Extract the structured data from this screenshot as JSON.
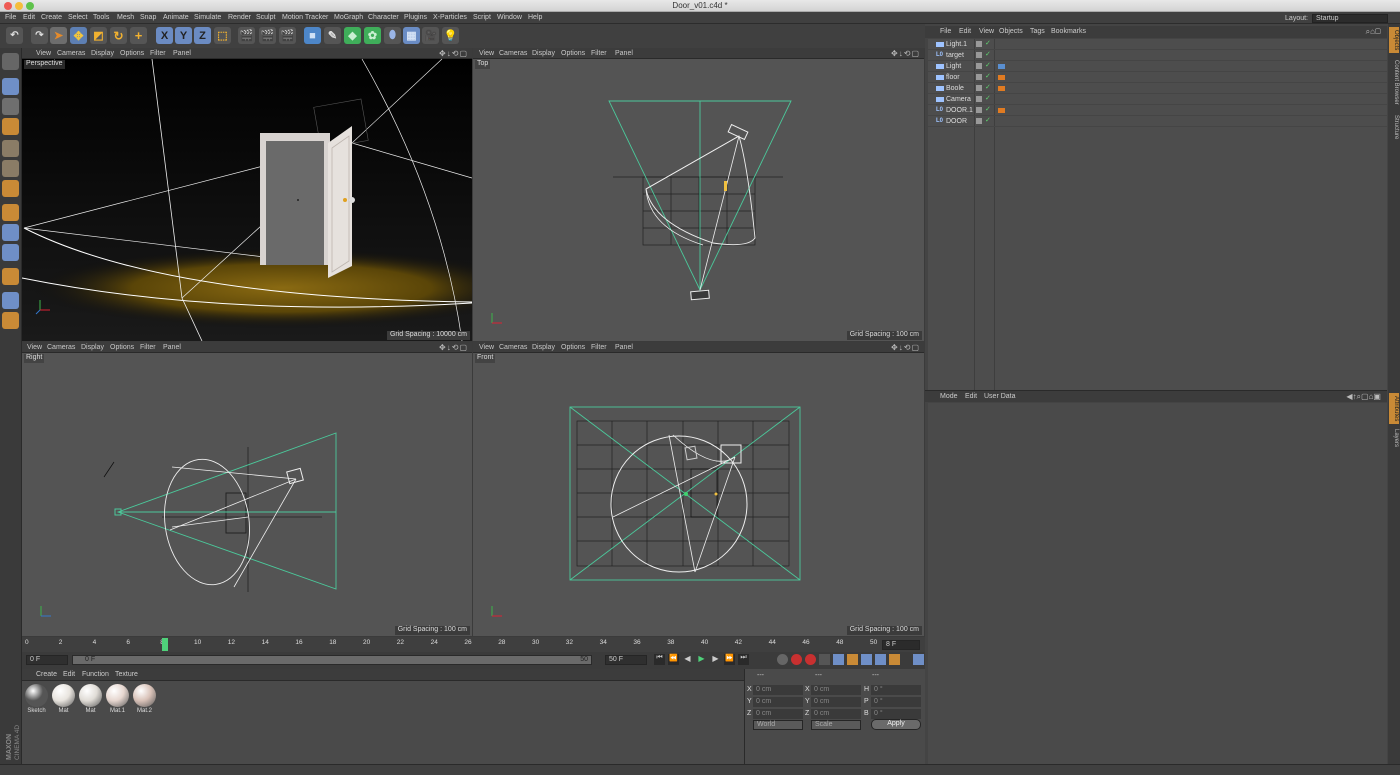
{
  "window": {
    "title": "Door_v01.c4d *"
  },
  "menu": [
    "File",
    "Edit",
    "Create",
    "Select",
    "Tools",
    "Mesh",
    "Snap",
    "Animate",
    "Simulate",
    "Render",
    "Sculpt",
    "Motion Tracker",
    "MoGraph",
    "Character",
    "Plugins",
    "X-Particles",
    "Script",
    "Window",
    "Help"
  ],
  "layout": {
    "label": "Layout:",
    "value": "Startup"
  },
  "toolbar": {
    "x_label": "X",
    "y_label": "Y",
    "z_label": "Z"
  },
  "viewport_menu": [
    "View",
    "Cameras",
    "Display",
    "Options",
    "Filter",
    "Panel"
  ],
  "viewports": {
    "perspective": {
      "label": "Perspective",
      "grid": "Grid Spacing : 10000 cm"
    },
    "top": {
      "label": "Top",
      "grid": "Grid Spacing : 100 cm"
    },
    "right": {
      "label": "Right",
      "grid": "Grid Spacing : 100 cm"
    },
    "front": {
      "label": "Front",
      "grid": "Grid Spacing : 100 cm"
    }
  },
  "timeline": {
    "ticks": [
      "0",
      "2",
      "4",
      "6",
      "8",
      "10",
      "12",
      "14",
      "16",
      "18",
      "20",
      "22",
      "24",
      "26",
      "28",
      "30",
      "32",
      "34",
      "36",
      "38",
      "40",
      "42",
      "44",
      "46",
      "48",
      "50"
    ],
    "current_label": "8",
    "end_field": "8 F",
    "start_field": "0 F",
    "range_start": "0 F",
    "range_end": "50",
    "end_frame_field": "50 F"
  },
  "material_menu": [
    "Create",
    "Edit",
    "Function",
    "Texture"
  ],
  "materials": [
    {
      "name": "Sketch",
      "color": "#555"
    },
    {
      "name": "Mat",
      "color": "#e8e4de"
    },
    {
      "name": "Mat",
      "color": "#e0dcd6"
    },
    {
      "name": "Mat.1",
      "color": "#e6d6cf"
    },
    {
      "name": "Mat.2",
      "color": "#d9c2b8"
    }
  ],
  "coordinates": {
    "headers": [
      "---",
      "---",
      "---"
    ],
    "rows": [
      {
        "a": "X",
        "av": "0 cm",
        "b": "X",
        "bv": "0 cm",
        "c": "H",
        "cv": "0 °"
      },
      {
        "a": "Y",
        "av": "0 cm",
        "b": "Y",
        "bv": "0 cm",
        "c": "P",
        "cv": "0 °"
      },
      {
        "a": "Z",
        "av": "0 cm",
        "b": "Z",
        "bv": "0 cm",
        "c": "B",
        "cv": "0 °"
      }
    ],
    "world": "World",
    "scale": "Scale",
    "apply": "Apply"
  },
  "brand": {
    "line1": "MAXON",
    "line2": "CINEMA 4D"
  },
  "objects_menu": [
    "File",
    "Edit",
    "View",
    "Objects",
    "Tags",
    "Bookmarks"
  ],
  "objects": [
    {
      "name": "Light.1",
      "prefix": ""
    },
    {
      "name": "target",
      "prefix": "L0"
    },
    {
      "name": "Light",
      "prefix": ""
    },
    {
      "name": "floor",
      "prefix": ""
    },
    {
      "name": "Boole",
      "prefix": ""
    },
    {
      "name": "Camera",
      "prefix": ""
    },
    {
      "name": "DOOR.1",
      "prefix": "L0"
    },
    {
      "name": "DOOR",
      "prefix": "L0"
    }
  ],
  "attributes_menu": [
    "Mode",
    "Edit",
    "User Data"
  ],
  "side_tabs_top": [
    "Objects",
    "Content Browser",
    "Structure"
  ],
  "side_tabs_bottom": [
    "Attributes",
    "Layers"
  ]
}
